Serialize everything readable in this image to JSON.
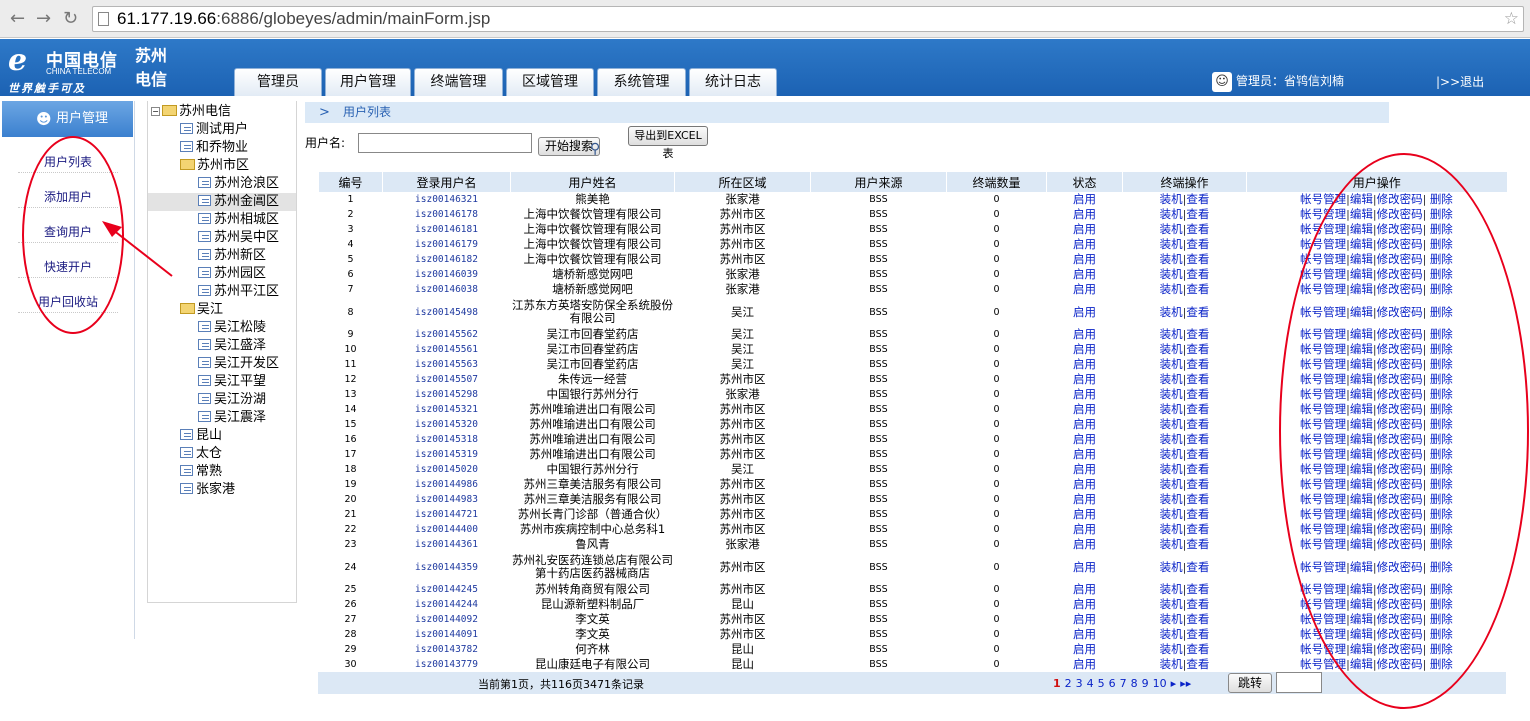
{
  "browser": {
    "url_host": "61.177.19.66",
    "url_rest": ":6886/globeyes/admin/mainForm.jsp"
  },
  "header": {
    "logo_cn": "中国电信",
    "logo_en": "CHINA TELECOM",
    "logo_slogan": "世界触手可及",
    "city_line1": "苏州",
    "city_line2": "电信",
    "tabs": [
      "管理员",
      "用户管理",
      "终端管理",
      "区域管理",
      "系统管理",
      "统计日志"
    ],
    "admin_label": "管理员：省鸨信刘楠",
    "logout": "|>>退出"
  },
  "sidebar": {
    "title": "用户管理",
    "items": [
      "用户列表",
      "添加用户",
      "查询用户",
      "快速开户",
      "用户回收站"
    ]
  },
  "tree": {
    "nodes": [
      {
        "label": "苏州电信",
        "level": 0,
        "type": "folder",
        "box": "⊟"
      },
      {
        "label": "测试用户",
        "level": 1,
        "type": "doc"
      },
      {
        "label": "和乔物业",
        "level": 1,
        "type": "doc"
      },
      {
        "label": "苏州市区",
        "level": 1,
        "type": "folder"
      },
      {
        "label": "苏州沧浪区",
        "level": 2,
        "type": "doc"
      },
      {
        "label": "苏州金阊区",
        "level": 2,
        "type": "doc",
        "selected": true
      },
      {
        "label": "苏州相城区",
        "level": 2,
        "type": "doc"
      },
      {
        "label": "苏州吴中区",
        "level": 2,
        "type": "doc"
      },
      {
        "label": "苏州新区",
        "level": 2,
        "type": "doc"
      },
      {
        "label": "苏州园区",
        "level": 2,
        "type": "doc"
      },
      {
        "label": "苏州平江区",
        "level": 2,
        "type": "doc"
      },
      {
        "label": "吴江",
        "level": 1,
        "type": "folder"
      },
      {
        "label": "吴江松陵",
        "level": 2,
        "type": "doc"
      },
      {
        "label": "吴江盛泽",
        "level": 2,
        "type": "doc"
      },
      {
        "label": "吴江开发区",
        "level": 2,
        "type": "doc"
      },
      {
        "label": "吴江平望",
        "level": 2,
        "type": "doc"
      },
      {
        "label": "吴江汾湖",
        "level": 2,
        "type": "doc"
      },
      {
        "label": "吴江震泽",
        "level": 2,
        "type": "doc"
      },
      {
        "label": "昆山",
        "level": 1,
        "type": "doc"
      },
      {
        "label": "太仓",
        "level": 1,
        "type": "doc"
      },
      {
        "label": "常熟",
        "level": 1,
        "type": "doc"
      },
      {
        "label": "张家港",
        "level": 1,
        "type": "doc"
      }
    ]
  },
  "main": {
    "breadcrumb": "用户列表",
    "search_label": "用户名:",
    "search_value": "",
    "search_button": "开始搜索",
    "export_button": "导出到EXCEL表",
    "table": {
      "headers": [
        "编号",
        "登录用户名",
        "用户姓名",
        "所在区域",
        "用户来源",
        "终端数量",
        "状态",
        "终端操作",
        "用户操作"
      ],
      "status_link": "启用",
      "terminal_ops": [
        "装机",
        "查看"
      ],
      "user_ops": [
        "帐号管理",
        "编辑",
        "修改密码",
        "删除"
      ],
      "rows": [
        {
          "no": "1",
          "login": "isz00146321",
          "name": "熊美艳",
          "area": "张家港",
          "source": "BSS",
          "count": "0"
        },
        {
          "no": "2",
          "login": "isz00146178",
          "name": "上海中饮餐饮管理有限公司",
          "area": "苏州市区",
          "source": "BSS",
          "count": "0"
        },
        {
          "no": "3",
          "login": "isz00146181",
          "name": "上海中饮餐饮管理有限公司",
          "area": "苏州市区",
          "source": "BSS",
          "count": "0"
        },
        {
          "no": "4",
          "login": "isz00146179",
          "name": "上海中饮餐饮管理有限公司",
          "area": "苏州市区",
          "source": "BSS",
          "count": "0"
        },
        {
          "no": "5",
          "login": "isz00146182",
          "name": "上海中饮餐饮管理有限公司",
          "area": "苏州市区",
          "source": "BSS",
          "count": "0"
        },
        {
          "no": "6",
          "login": "isz00146039",
          "name": "塘桥新感觉网吧",
          "area": "张家港",
          "source": "BSS",
          "count": "0"
        },
        {
          "no": "7",
          "login": "isz00146038",
          "name": "塘桥新感觉网吧",
          "area": "张家港",
          "source": "BSS",
          "count": "0"
        },
        {
          "no": "8",
          "login": "isz00145498",
          "name": "江苏东方英塔安防保全系统股份有限公司",
          "area": "吴江",
          "source": "BSS",
          "count": "0",
          "tall": true
        },
        {
          "no": "9",
          "login": "isz00145562",
          "name": "吴江市回春堂药店",
          "area": "吴江",
          "source": "BSS",
          "count": "0"
        },
        {
          "no": "10",
          "login": "isz00145561",
          "name": "吴江市回春堂药店",
          "area": "吴江",
          "source": "BSS",
          "count": "0"
        },
        {
          "no": "11",
          "login": "isz00145563",
          "name": "吴江市回春堂药店",
          "area": "吴江",
          "source": "BSS",
          "count": "0"
        },
        {
          "no": "12",
          "login": "isz00145507",
          "name": "朱传远一经营",
          "area": "苏州市区",
          "source": "BSS",
          "count": "0"
        },
        {
          "no": "13",
          "login": "isz00145298",
          "name": "中国银行苏州分行",
          "area": "张家港",
          "source": "BSS",
          "count": "0"
        },
        {
          "no": "14",
          "login": "isz00145321",
          "name": "苏州唯瑜进出口有限公司",
          "area": "苏州市区",
          "source": "BSS",
          "count": "0"
        },
        {
          "no": "15",
          "login": "isz00145320",
          "name": "苏州唯瑜进出口有限公司",
          "area": "苏州市区",
          "source": "BSS",
          "count": "0"
        },
        {
          "no": "16",
          "login": "isz00145318",
          "name": "苏州唯瑜进出口有限公司",
          "area": "苏州市区",
          "source": "BSS",
          "count": "0"
        },
        {
          "no": "17",
          "login": "isz00145319",
          "name": "苏州唯瑜进出口有限公司",
          "area": "苏州市区",
          "source": "BSS",
          "count": "0"
        },
        {
          "no": "18",
          "login": "isz00145020",
          "name": "中国银行苏州分行",
          "area": "吴江",
          "source": "BSS",
          "count": "0"
        },
        {
          "no": "19",
          "login": "isz00144986",
          "name": "苏州三章美洁服务有限公司",
          "area": "苏州市区",
          "source": "BSS",
          "count": "0"
        },
        {
          "no": "20",
          "login": "isz00144983",
          "name": "苏州三章美洁服务有限公司",
          "area": "苏州市区",
          "source": "BSS",
          "count": "0"
        },
        {
          "no": "21",
          "login": "isz00144721",
          "name": "苏州长青门诊部（普通合伙）",
          "area": "苏州市区",
          "source": "BSS",
          "count": "0"
        },
        {
          "no": "22",
          "login": "isz00144400",
          "name": "苏州市疾病控制中心总务科1",
          "area": "苏州市区",
          "source": "BSS",
          "count": "0"
        },
        {
          "no": "23",
          "login": "isz00144361",
          "name": "鲁风青",
          "area": "张家港",
          "source": "BSS",
          "count": "0"
        },
        {
          "no": "24",
          "login": "isz00144359",
          "name": "苏州礼安医药连锁总店有限公司第十药店医药器械商店",
          "area": "苏州市区",
          "source": "BSS",
          "count": "0",
          "tall": true
        },
        {
          "no": "25",
          "login": "isz00144245",
          "name": "苏州转角商贸有限公司",
          "area": "苏州市区",
          "source": "BSS",
          "count": "0"
        },
        {
          "no": "26",
          "login": "isz00144244",
          "name": "昆山源新塑料制品厂",
          "area": "昆山",
          "source": "BSS",
          "count": "0"
        },
        {
          "no": "27",
          "login": "isz00144092",
          "name": "李文英",
          "area": "苏州市区",
          "source": "BSS",
          "count": "0"
        },
        {
          "no": "28",
          "login": "isz00144091",
          "name": "李文英",
          "area": "苏州市区",
          "source": "BSS",
          "count": "0"
        },
        {
          "no": "29",
          "login": "isz00143782",
          "name": "何齐林",
          "area": "昆山",
          "source": "BSS",
          "count": "0"
        },
        {
          "no": "30",
          "login": "isz00143779",
          "name": "昆山康廷电子有限公司",
          "area": "昆山",
          "source": "BSS",
          "count": "0"
        }
      ]
    },
    "footer": {
      "page_info": "当前第1页，共116页3471条记录",
      "pages": [
        "1",
        "2",
        "3",
        "4",
        "5",
        "6",
        "7",
        "8",
        "9",
        "10",
        "▸",
        "▸▸"
      ],
      "jump_button": "跳转",
      "jump_value": ""
    }
  },
  "annotation_color": "#e8001c"
}
